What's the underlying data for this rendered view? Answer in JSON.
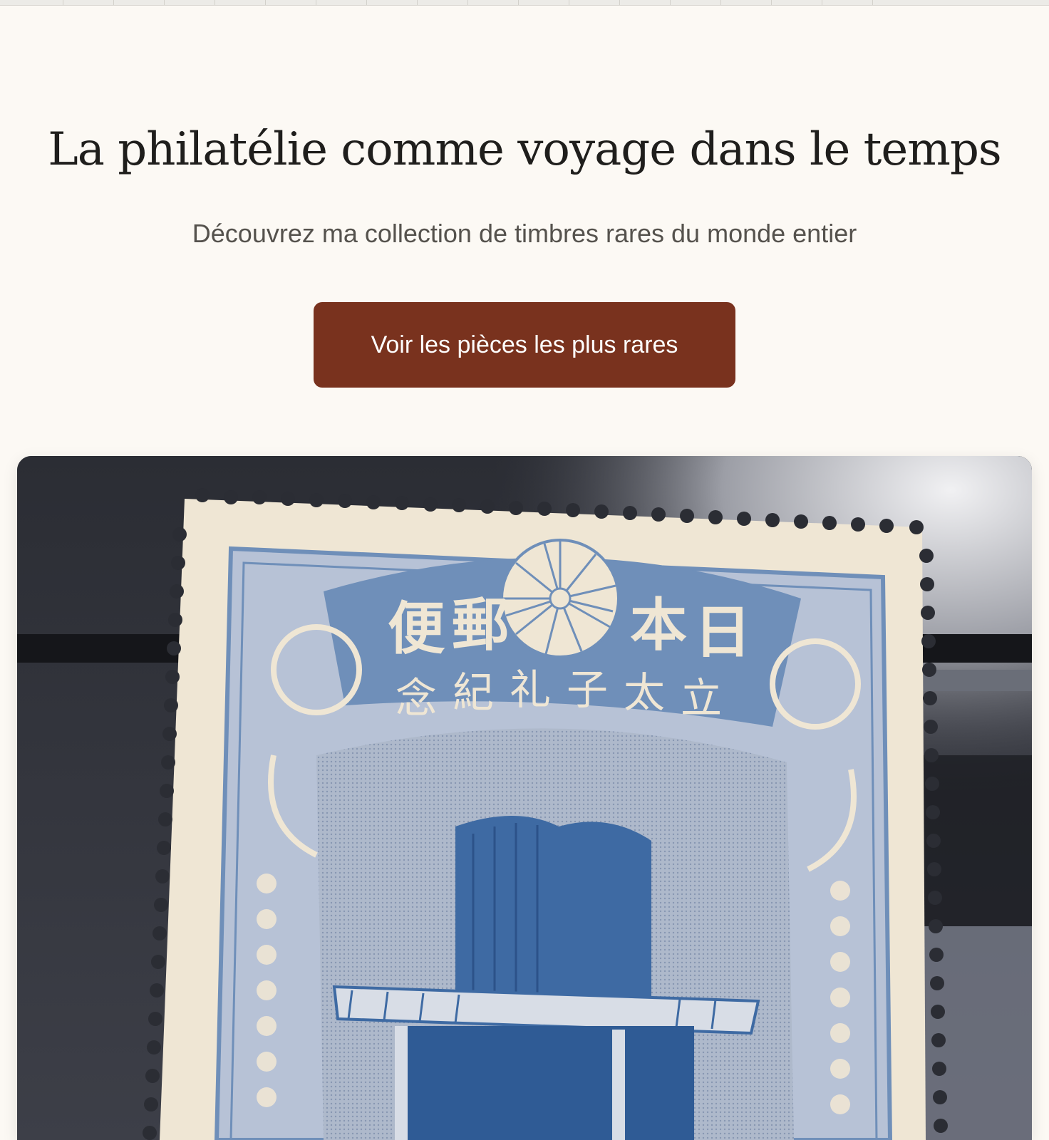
{
  "hero": {
    "title": "La philatélie comme voyage dans le temps",
    "subtitle": "Découvrez ma collection de timbres rares du monde entier",
    "cta_label": "Voir les pièces les plus rares"
  },
  "featured_image": {
    "stamp_top_chars": [
      "郵",
      "便",
      "日",
      "本"
    ],
    "stamp_bottom_chars": [
      "立",
      "太",
      "子",
      "礼",
      "紀",
      "念"
    ]
  },
  "colors": {
    "background": "#fcf9f4",
    "accent": "#79321e",
    "stamp_blue": "#6f8fb9",
    "paper": "#efe6d4"
  },
  "icons": [
    "chrysanthemum-crest-icon"
  ]
}
